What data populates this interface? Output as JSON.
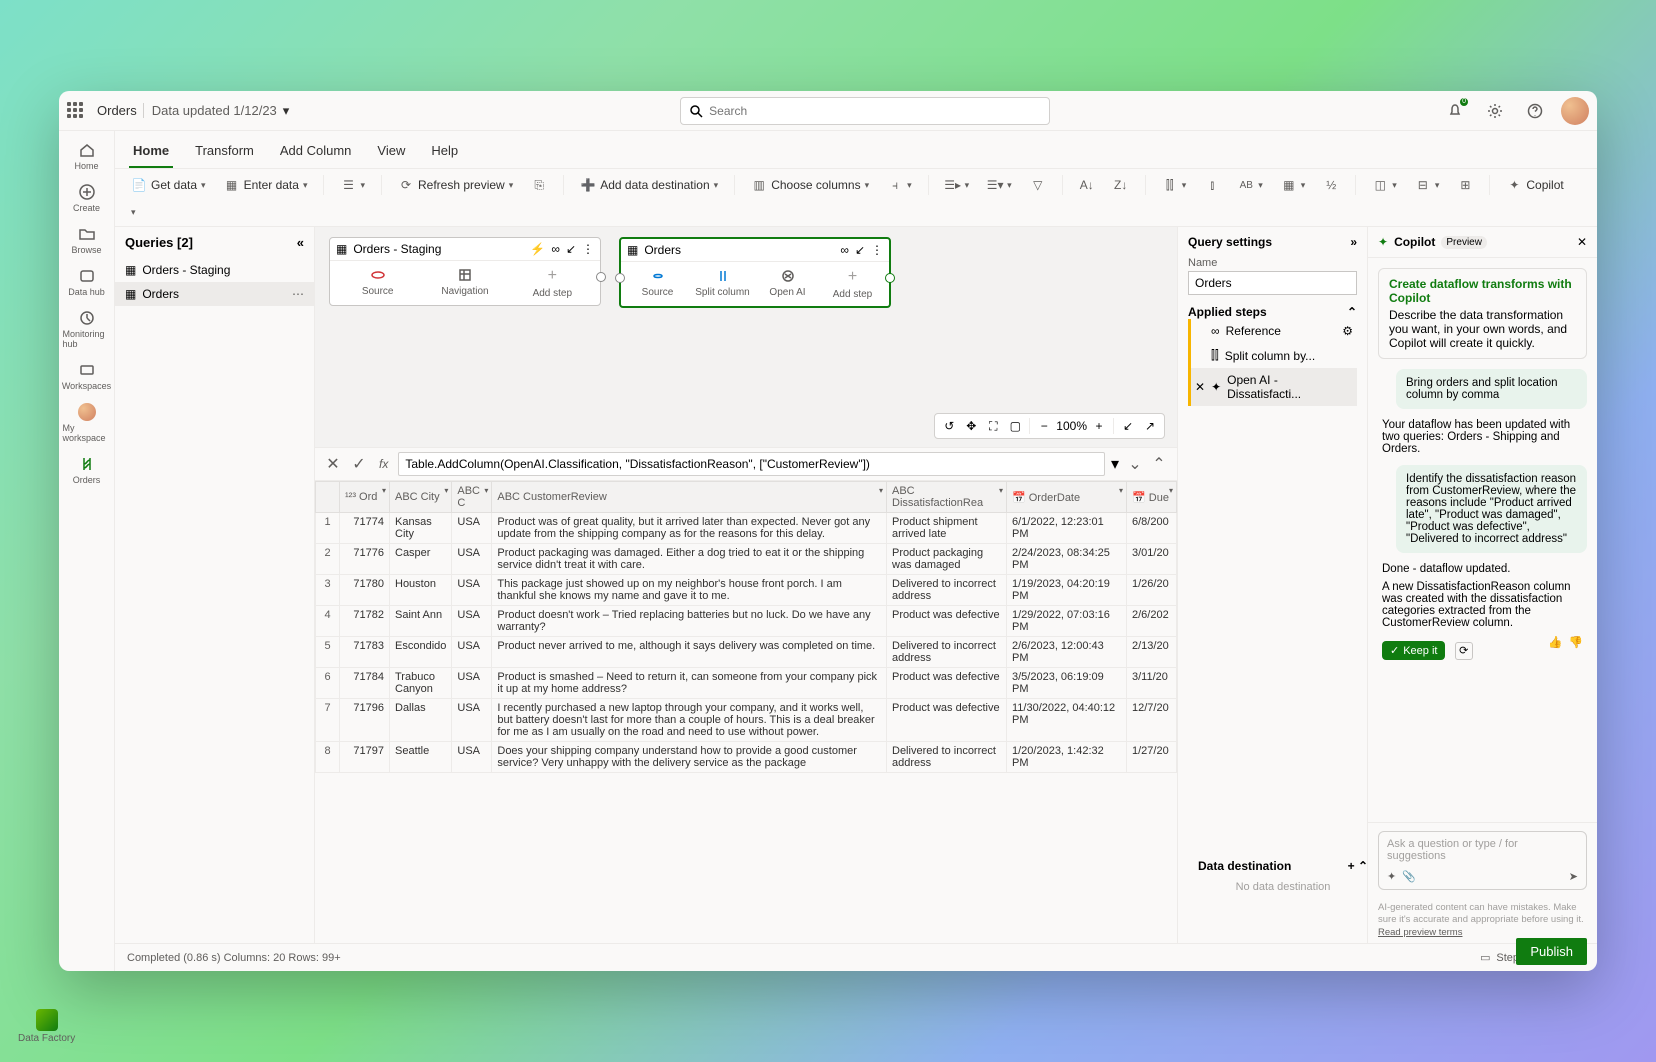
{
  "header": {
    "crumb": "Orders",
    "updated": "Data updated 1/12/23",
    "search_placeholder": "Search"
  },
  "leftrail": {
    "home": "Home",
    "create": "Create",
    "browse": "Browse",
    "datahub": "Data hub",
    "monitoring": "Monitoring hub",
    "workspaces": "Workspaces",
    "myws": "My workspace",
    "orders": "Orders"
  },
  "tabs": {
    "home": "Home",
    "transform": "Transform",
    "addcol": "Add Column",
    "view": "View",
    "help": "Help"
  },
  "ribbon": {
    "getdata": "Get data",
    "enterdata": "Enter data",
    "refresh": "Refresh preview",
    "adddest": "Add data destination",
    "choose": "Choose columns",
    "copilot": "Copilot"
  },
  "queries": {
    "title": "Queries [2]",
    "items": [
      {
        "label": "Orders - Staging",
        "sel": false
      },
      {
        "label": "Orders",
        "sel": true
      }
    ]
  },
  "cards": {
    "staging": {
      "title": "Orders - Staging",
      "steps": [
        "Source",
        "Navigation",
        "Add step"
      ]
    },
    "orders": {
      "title": "Orders",
      "steps": [
        "Source",
        "Split column",
        "Open AI",
        "Add step"
      ]
    }
  },
  "zoom": "100%",
  "fx": "Table.AddColumn(OpenAI.Classification, \"DissatisfactionReason\", [\"CustomerReview\"])",
  "cols": [
    "",
    "¹²³ Ord",
    "ABC City",
    "ABC C",
    "ABC CustomerReview",
    "ABC DissatisfactionRea",
    "📅 OrderDate",
    "📅 Due"
  ],
  "rows": [
    {
      "i": 1,
      "ord": "71774",
      "city": "Kansas City",
      "c": "USA",
      "rev": "Product was of great quality, but it arrived later than expected. Never got any update from the shipping company as for the reasons for this delay.",
      "dis": "Product shipment arrived late",
      "od": "6/1/2022, 12:23:01 PM",
      "due": "6/8/200"
    },
    {
      "i": 2,
      "ord": "71776",
      "city": "Casper",
      "c": "USA",
      "rev": "Product packaging was damaged. Either a dog tried to eat it or the shipping service didn't treat it with care.",
      "dis": "Product packaging was damaged",
      "od": "2/24/2023, 08:34:25 PM",
      "due": "3/01/20"
    },
    {
      "i": 3,
      "ord": "71780",
      "city": "Houston",
      "c": "USA",
      "rev": "This package just showed up on my neighbor's house front porch. I am thankful she knows my name and gave it to me.",
      "dis": "Delivered to incorrect address",
      "od": "1/19/2023, 04:20:19 PM",
      "due": "1/26/20"
    },
    {
      "i": 4,
      "ord": "71782",
      "city": "Saint Ann",
      "c": "USA",
      "rev": "Product doesn't work – Tried replacing batteries but no luck. Do we have any warranty?",
      "dis": "Product was defective",
      "od": "1/29/2022, 07:03:16 PM",
      "due": "2/6/202"
    },
    {
      "i": 5,
      "ord": "71783",
      "city": "Escondido",
      "c": "USA",
      "rev": "Product never arrived to me, although it says delivery was completed on time.",
      "dis": "Delivered to incorrect address",
      "od": "2/6/2023, 12:00:43 PM",
      "due": "2/13/20"
    },
    {
      "i": 6,
      "ord": "71784",
      "city": "Trabuco Canyon",
      "c": "USA",
      "rev": "Product is smashed – Need to return it, can someone from your company pick it up at my home address?",
      "dis": "Product was defective",
      "od": "3/5/2023, 06:19:09 PM",
      "due": "3/11/20"
    },
    {
      "i": 7,
      "ord": "71796",
      "city": "Dallas",
      "c": "USA",
      "rev": "I recently purchased a new laptop through your company, and it works well, but battery doesn't last for more than a couple of hours. This is a deal breaker for me as I am usually on the road and need to use without power.",
      "dis": "Product was defective",
      "od": "11/30/2022, 04:40:12 PM",
      "due": "12/7/20"
    },
    {
      "i": 8,
      "ord": "71797",
      "city": "Seattle",
      "c": "USA",
      "rev": "Does your shipping company understand how to provide a good customer service? Very unhappy with the delivery service as the package",
      "dis": "Delivered to incorrect address",
      "od": "1/20/2023, 1:42:32 PM",
      "due": "1/27/20"
    }
  ],
  "settings": {
    "title": "Query settings",
    "name_lbl": "Name",
    "name_val": "Orders",
    "steps_lbl": "Applied steps",
    "steps": [
      {
        "t": "Reference",
        "ic": "link"
      },
      {
        "t": "Split column by...",
        "ic": "split"
      },
      {
        "t": "Open AI - Dissatisfacti...",
        "ic": "ai",
        "sel": true
      }
    ],
    "dest_title": "Data destination",
    "dest_empty": "No data destination"
  },
  "copilot": {
    "title": "Copilot",
    "pill": "Preview",
    "card_title": "Create dataflow transforms with Copilot",
    "card_body": "Describe the data transformation you want, in your own words, and Copilot will create it quickly.",
    "u1": "Bring orders and split location column by comma",
    "a1": "Your dataflow has been updated with two queries:  Orders - Shipping and Orders.",
    "u2": "Identify the dissatisfaction reason from CustomerReview, where the reasons include \"Product arrived late\", \"Product was damaged\", \"Product was defective\", \"Delivered to incorrect address\"",
    "a2a": "Done - dataflow updated.",
    "a2b": "A new DissatisfactionReason column was created with the dissatisfaction categories extracted from the CustomerReview column.",
    "keep": "Keep it",
    "placeholder": "Ask a question or type / for suggestions",
    "note": "AI-generated content can have mistakes. Make sure it's accurate and appropriate before using it.",
    "note_link": "Read preview terms"
  },
  "status": {
    "left": "Completed (0.86 s)  Columns: 20  Rows: 99+",
    "step": "Step"
  },
  "publish": "Publish",
  "corner": "Data Factory"
}
